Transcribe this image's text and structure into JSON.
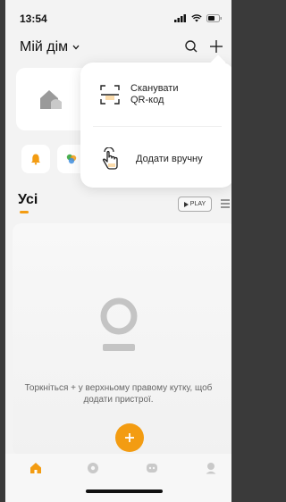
{
  "status_bar": {
    "time": "13:54"
  },
  "header": {
    "home_name": "Мій дім"
  },
  "popup": {
    "items": [
      {
        "label_line1": "Сканувати",
        "label_line2": "QR-код"
      },
      {
        "label": "Додати вручну"
      }
    ]
  },
  "section": {
    "title": "Усі",
    "play_label": "PLAY"
  },
  "empty_state": {
    "text": "Торкніться + у верхньому правому кутку, щоб додати пристрої."
  },
  "colors": {
    "accent": "#f39c12",
    "background": "#f3f3f3"
  },
  "tabs": [
    "home-icon",
    "scene-icon",
    "smart-icon",
    "profile-icon"
  ]
}
